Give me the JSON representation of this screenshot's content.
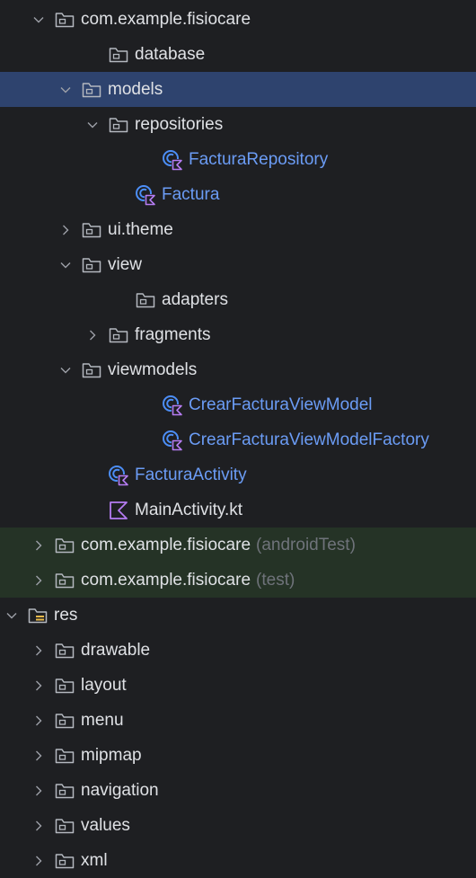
{
  "tree": [
    {
      "label": "com.example.fisiocare",
      "chevron": "down",
      "icon": "package",
      "depth": 0
    },
    {
      "label": "database",
      "chevron": "none",
      "icon": "package",
      "depth": 2
    },
    {
      "label": "models",
      "chevron": "down",
      "icon": "package",
      "depth": 1,
      "selected": true
    },
    {
      "label": "repositories",
      "chevron": "down",
      "icon": "package",
      "depth": 2
    },
    {
      "label": "FacturaRepository",
      "chevron": "none",
      "icon": "kotlin-class",
      "depth": 4,
      "kind": "class"
    },
    {
      "label": "Factura",
      "chevron": "none",
      "icon": "kotlin-class",
      "depth": 3,
      "kind": "class"
    },
    {
      "label": "ui.theme",
      "chevron": "right",
      "icon": "package",
      "depth": 1
    },
    {
      "label": "view",
      "chevron": "down",
      "icon": "package",
      "depth": 1
    },
    {
      "label": "adapters",
      "chevron": "none",
      "icon": "package",
      "depth": 3
    },
    {
      "label": "fragments",
      "chevron": "right",
      "icon": "package",
      "depth": 2
    },
    {
      "label": "viewmodels",
      "chevron": "down",
      "icon": "package",
      "depth": 1
    },
    {
      "label": "CrearFacturaViewModel",
      "chevron": "none",
      "icon": "kotlin-class",
      "depth": 4,
      "kind": "class"
    },
    {
      "label": "CrearFacturaViewModelFactory",
      "chevron": "none",
      "icon": "kotlin-class",
      "depth": 4,
      "kind": "class"
    },
    {
      "label": "FacturaActivity",
      "chevron": "none",
      "icon": "kotlin-class",
      "depth": 2,
      "kind": "class"
    },
    {
      "label": "MainActivity.kt",
      "chevron": "none",
      "icon": "kotlin-file",
      "depth": 2
    },
    {
      "label": "com.example.fisiocare",
      "suffix": "(androidTest)",
      "chevron": "right",
      "icon": "package",
      "depth": 0,
      "highlight": "green"
    },
    {
      "label": "com.example.fisiocare",
      "suffix": "(test)",
      "chevron": "right",
      "icon": "package",
      "depth": 0,
      "highlight": "green"
    },
    {
      "label": "res",
      "chevron": "down",
      "icon": "resource-folder",
      "depth": -1
    },
    {
      "label": "drawable",
      "chevron": "right",
      "icon": "package",
      "depth": 0
    },
    {
      "label": "layout",
      "chevron": "right",
      "icon": "package",
      "depth": 0
    },
    {
      "label": "menu",
      "chevron": "right",
      "icon": "package",
      "depth": 0
    },
    {
      "label": "mipmap",
      "chevron": "right",
      "icon": "package",
      "depth": 0
    },
    {
      "label": "navigation",
      "chevron": "right",
      "icon": "package",
      "depth": 0
    },
    {
      "label": "values",
      "chevron": "right",
      "icon": "package",
      "depth": 0
    },
    {
      "label": "xml",
      "chevron": "right",
      "icon": "package",
      "depth": 0
    }
  ]
}
